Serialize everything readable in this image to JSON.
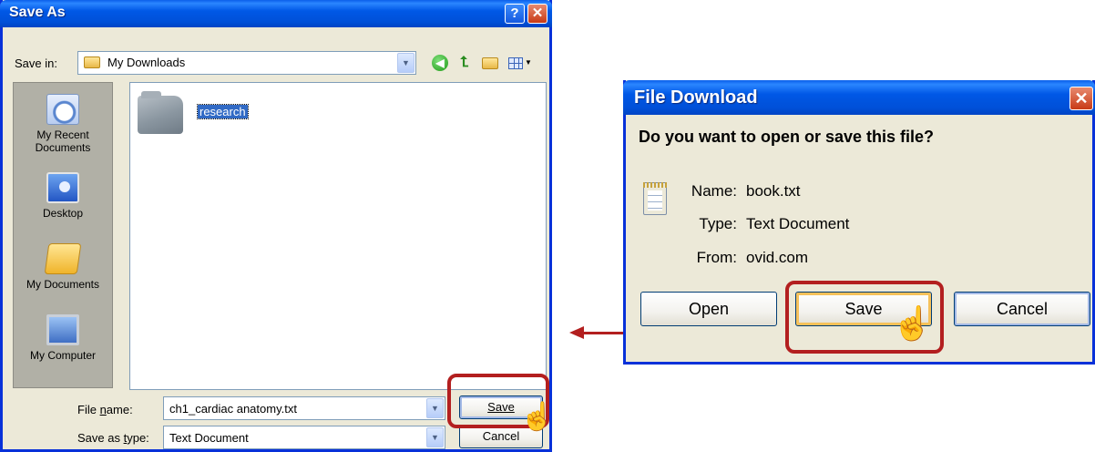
{
  "save_as": {
    "title": "Save As",
    "help_glyph": "?",
    "close_glyph": "✕",
    "save_in_label": "Save in:",
    "save_in_value": "My Downloads",
    "places": [
      {
        "label_line1": "My Recent",
        "label_line2": "Documents",
        "icon": "recent-documents-icon"
      },
      {
        "label_line1": "Desktop",
        "label_line2": "",
        "icon": "desktop-icon"
      },
      {
        "label_line1": "My Documents",
        "label_line2": "",
        "icon": "my-documents-icon"
      },
      {
        "label_line1": "My Computer",
        "label_line2": "",
        "icon": "my-computer-icon"
      }
    ],
    "files": [
      {
        "name": "research",
        "icon": "folder-icon",
        "selected": true
      }
    ],
    "file_name_label": "File name:",
    "file_name_value": "ch1_cardiac anatomy.txt",
    "save_as_type_label": "Save as type:",
    "save_as_type_value": "Text Document",
    "save_button": "Save",
    "cancel_button": "Cancel"
  },
  "file_download": {
    "title": "File Download",
    "close_glyph": "✕",
    "question": "Do you want to open or save this file?",
    "name_label": "Name:",
    "name_value": "book.txt",
    "type_label": "Type:",
    "type_value": "Text Document",
    "from_label": "From:",
    "from_value": "ovid.com",
    "open_button": "Open",
    "save_button": "Save",
    "cancel_button": "Cancel"
  },
  "annotation": {
    "highlight_color": "#b31f1f",
    "arrow_direction": "from File Download Save to Save As dialog"
  },
  "colors": {
    "titlebar_blue": "#0058e6",
    "dialog_bg": "#ece9d8",
    "selection_blue": "#316ac5"
  }
}
